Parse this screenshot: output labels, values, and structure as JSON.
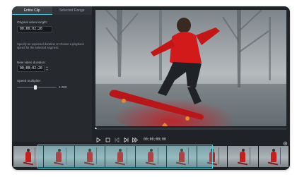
{
  "tabs": [
    {
      "label": "Entire Clip",
      "active": true
    },
    {
      "label": "Selected Range",
      "active": false
    }
  ],
  "panel": {
    "original_label": "Original video length:",
    "original_value": "00;00;02;20",
    "hint": "Specify an expected duration or choose a playback speed for the selected segment.",
    "new_label": "New video duration:",
    "new_value": "00;00;02;20",
    "speed_label": "Speed multiplier:",
    "speed_value": "1.000"
  },
  "player": {
    "timecode": "00;00;00;00"
  },
  "colors": {
    "accent": "#3fd1dc",
    "panel_bg": "#26292e",
    "window_bg": "#1f2226"
  },
  "icons": {
    "play": "play-icon",
    "stop": "stop-icon",
    "prev": "previous-frame-icon",
    "next": "next-frame-icon",
    "fast_forward": "fast-forward-icon",
    "settings": "gear-icon"
  }
}
